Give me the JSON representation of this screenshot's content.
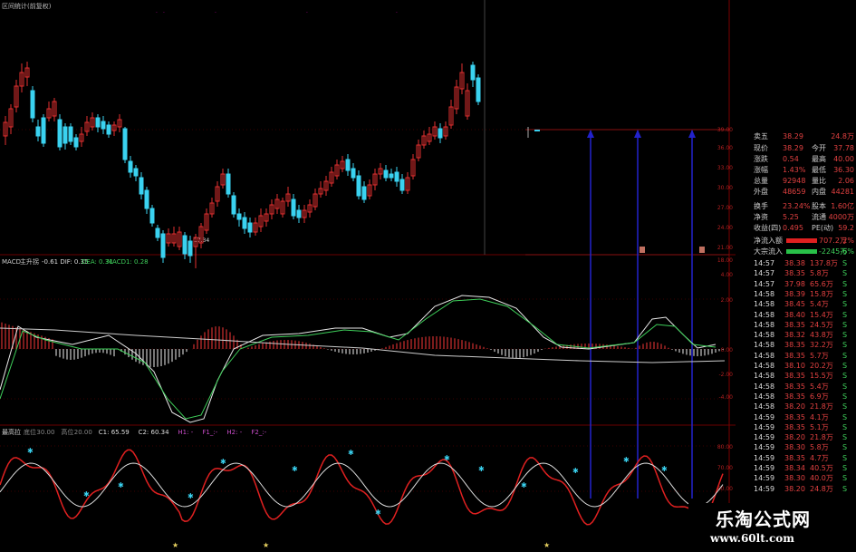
{
  "main_title": "区间统计(前复权)",
  "main_low_label": "17.34",
  "macd_header": {
    "prefix": "MACD",
    "name": "主升拐",
    "dif_label": "-0.61 DIF: 0.35",
    "dea_label": "DEA: 0.31",
    "macd_label": "MACD1: 0.28"
  },
  "osc_header": {
    "name": "最高拉",
    "items": [
      "底位",
      "30.00",
      "高位",
      "20.00",
      "C1: 65.59",
      "C2: 60.34",
      "H1: -",
      "F1_:-",
      "H2: -",
      "F2_:-"
    ]
  },
  "price_axis": [
    "39.00",
    "36.00",
    "33.00",
    "30.00",
    "27.00",
    "24.00",
    "21.00",
    "18.00"
  ],
  "macd_axis": [
    "4.00",
    "2.00",
    "0.00",
    "-2.00",
    "-4.00"
  ],
  "osc_axis": [
    "80.00",
    "70.00",
    "60.00"
  ],
  "quote": [
    {
      "label": "卖五",
      "value": "38.29",
      "extra_label": "",
      "extra_value": "24.8万"
    },
    {
      "label": "现价",
      "value": "38.29",
      "extra_label": "今开",
      "extra_value": "37.78"
    },
    {
      "label": "涨跌",
      "value": "0.54",
      "extra_label": "最高",
      "extra_value": "40.00"
    },
    {
      "label": "涨幅",
      "value": "1.43%",
      "extra_label": "最低",
      "extra_value": "36.30"
    },
    {
      "label": "总量",
      "value": "92948",
      "extra_label": "量比",
      "extra_value": "2.06"
    },
    {
      "label": "外盘",
      "value": "48659",
      "extra_label": "内盘",
      "extra_value": "44281"
    },
    {
      "label": "换手",
      "value": "23.24%",
      "extra_label": "股本",
      "extra_value": "1.60亿"
    },
    {
      "label": "净资",
      "value": "5.25",
      "extra_label": "流通",
      "extra_value": "4000万"
    },
    {
      "label": "收益(四)",
      "value": "0.495",
      "extra_label": "PE(动)",
      "extra_value": "59.2"
    }
  ],
  "flows": [
    {
      "label": "净流入额",
      "value": "707.2万",
      "pct": "2%"
    },
    {
      "label": "大宗流入",
      "value": "-2245万",
      "pct": "-6%"
    }
  ],
  "ticks": [
    {
      "time": "14:57",
      "price": "38.38",
      "vol": "137.8万",
      "side": "S"
    },
    {
      "time": "14:57",
      "price": "38.35",
      "vol": "5.8万",
      "side": "S"
    },
    {
      "time": "14:57",
      "price": "37.98",
      "vol": "65.6万",
      "side": "S"
    },
    {
      "time": "14:58",
      "price": "38.39",
      "vol": "15.8万",
      "side": "S"
    },
    {
      "time": "14:58",
      "price": "38.45",
      "vol": "5.4万",
      "side": "S"
    },
    {
      "time": "14:58",
      "price": "38.40",
      "vol": "15.4万",
      "side": "S"
    },
    {
      "time": "14:58",
      "price": "38.35",
      "vol": "24.5万",
      "side": "S"
    },
    {
      "time": "14:58",
      "price": "38.32",
      "vol": "43.8万",
      "side": "S"
    },
    {
      "time": "14:58",
      "price": "38.35",
      "vol": "32.2万",
      "side": "S"
    },
    {
      "time": "14:58",
      "price": "38.35",
      "vol": "5.7万",
      "side": "S"
    },
    {
      "time": "14:58",
      "price": "38.10",
      "vol": "20.2万",
      "side": "S"
    },
    {
      "time": "14:58",
      "price": "38.35",
      "vol": "15.5万",
      "side": "S"
    },
    {
      "time": "14:58",
      "price": "38.35",
      "vol": "5.4万",
      "side": "S"
    },
    {
      "time": "14:58",
      "price": "38.35",
      "vol": "6.9万",
      "side": "S"
    },
    {
      "time": "14:58",
      "price": "38.20",
      "vol": "21.8万",
      "side": "S"
    },
    {
      "time": "14:59",
      "price": "38.35",
      "vol": "4.1万",
      "side": "S"
    },
    {
      "time": "14:59",
      "price": "38.35",
      "vol": "5.1万",
      "side": "S"
    },
    {
      "time": "14:59",
      "price": "38.20",
      "vol": "21.8万",
      "side": "S"
    },
    {
      "time": "14:59",
      "price": "38.30",
      "vol": "5.8万",
      "side": "S"
    },
    {
      "time": "14:59",
      "price": "38.35",
      "vol": "4.7万",
      "side": "S"
    },
    {
      "time": "14:59",
      "price": "38.34",
      "vol": "40.5万",
      "side": "S"
    },
    {
      "time": "14:59",
      "price": "38.30",
      "vol": "40.0万",
      "side": "S"
    },
    {
      "time": "14:59",
      "price": "38.20",
      "vol": "24.8万",
      "side": "S"
    }
  ],
  "watermark": {
    "brand": "乐淘公式网",
    "url": "www.60lt.com"
  },
  "colors": {
    "up": "#e23030",
    "down": "#3ad2f0",
    "dif": "#e8e8e8",
    "dea": "#3ecf5a",
    "blue_line": "#2222cc",
    "grid": "#5a0000"
  }
}
